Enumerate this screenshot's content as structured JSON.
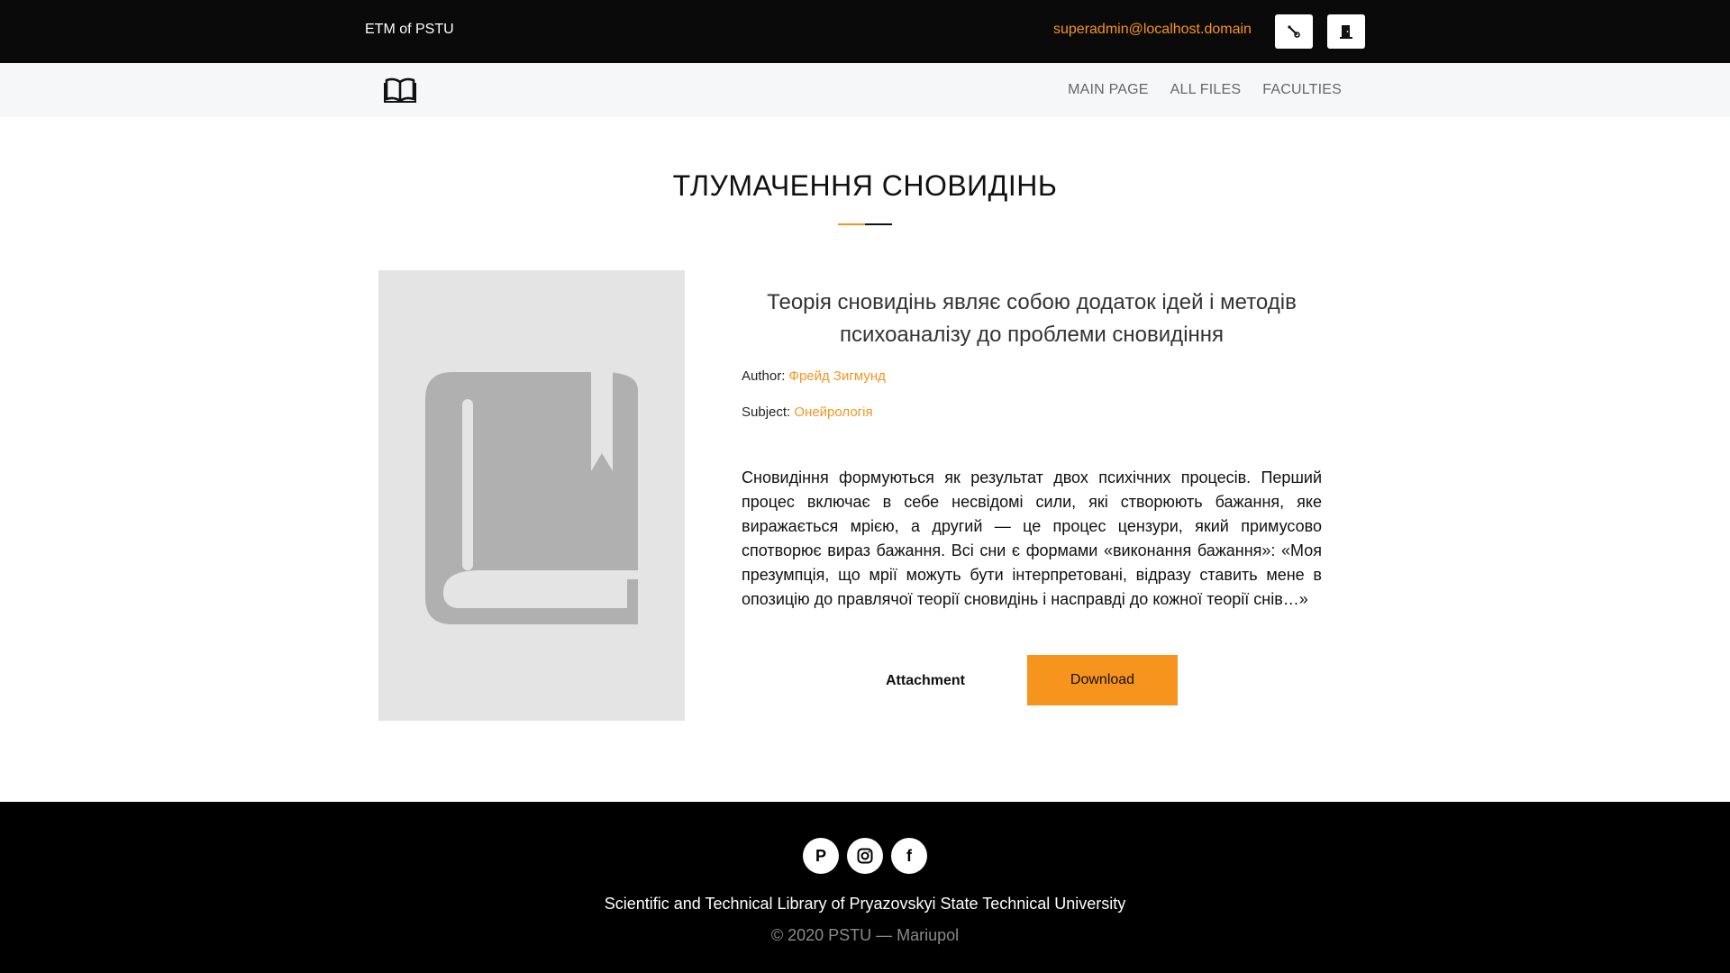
{
  "header": {
    "brand": "ETM of PSTU",
    "user_email": "superadmin@localhost.domain",
    "settings_icon": "wrench-icon",
    "logout_icon": "door-icon"
  },
  "nav": {
    "logo_icon": "open-book-icon",
    "links": [
      {
        "label": "MAIN PAGE"
      },
      {
        "label": "ALL FILES"
      },
      {
        "label": "FACULTIES"
      }
    ]
  },
  "page": {
    "title": "ТЛУМАЧЕННЯ СНОВИДІНЬ"
  },
  "book": {
    "cover_icon": "book-placeholder-icon",
    "heading": "Теорія сновидінь являє собою додаток ідей і методів психоаналізу до проблеми сновидіння",
    "author_label": "Author:",
    "author": "Фрейд Зигмунд",
    "subject_label": "Subject:",
    "subject": "Онейрологія",
    "description": "Сновидіння формуються як результат двох психічних процесів. Перший процес включає в себе несвідомі сили, які створюють бажання, яке виражається мрією, а другий — це процес цензури, який примусово спотворює вираз бажання. Всі сни є формами «виконання бажання»: «Моя презумпція, що мрії можуть бути інтерпретовані, відразу ставить мене в опозицію до правлячої теорії сновидінь і насправді до кожної теорії снів…»",
    "attachment_label": "Attachment",
    "download_label": "Download"
  },
  "footer": {
    "social": [
      {
        "icon": "p-logo-icon",
        "glyph": "P"
      },
      {
        "icon": "instagram-icon"
      },
      {
        "icon": "facebook-icon",
        "glyph": "f"
      }
    ],
    "library_name": "Scientific and Technical Library of Pryazovskyi State Technical University",
    "copyright": "© 2020 PSTU — Mariupol"
  },
  "colors": {
    "accent": "#f7941d",
    "topbar": "#0b0a0a",
    "navbar": "#f6f7f8",
    "footer": "#000000",
    "cover": "#e4e4e4"
  }
}
